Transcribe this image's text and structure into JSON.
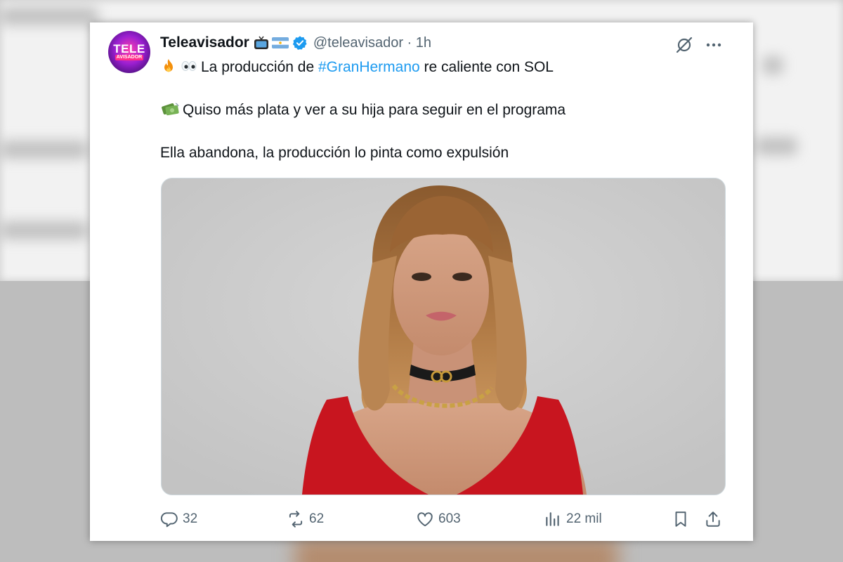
{
  "tweet": {
    "display_name": "Teleavisador",
    "handle_time": "@teleavisador · 1h",
    "avatar": {
      "line1": "TELE",
      "line2": "AVISADOR"
    },
    "line1": {
      "prefix": "La producción de ",
      "hashtag": "#GranHermano",
      "suffix": " re caliente con SOL"
    },
    "line2": "Quiso más plata y ver a su hija para seguir en el programa",
    "line3": "Ella abandona, la producción lo pinta como expulsión",
    "media_alt": "photo",
    "stats": {
      "replies": "32",
      "reposts": "62",
      "likes": "603",
      "views": "22 mil"
    }
  },
  "icons": [
    "tv-icon",
    "argentina-flag-icon",
    "verified-badge-icon",
    "grok-icon",
    "more-icon",
    "fire-emoji-icon",
    "eyes-emoji-icon",
    "money-emoji-icon",
    "reply-icon",
    "repost-icon",
    "like-icon",
    "views-icon",
    "bookmark-icon",
    "share-icon"
  ],
  "colors": {
    "link": "#1d9bf0",
    "text": "#0f1419",
    "muted": "#536471",
    "verified": "#1d9bf0"
  }
}
